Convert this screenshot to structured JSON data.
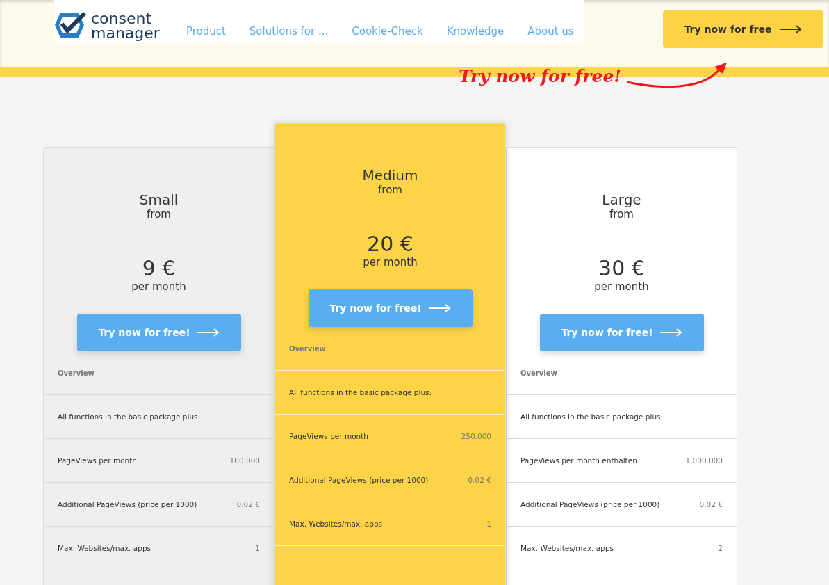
{
  "header": {
    "logo_text": [
      "consent",
      "manager"
    ],
    "nav": [
      {
        "label": "Product"
      },
      {
        "label": "Solutions for ..."
      },
      {
        "label": "Cookie-Check"
      },
      {
        "label": "Knowledge"
      },
      {
        "label": "About us"
      }
    ],
    "cta": {
      "label": "Try now for free"
    },
    "annotation": "Try now for free!"
  },
  "plans": [
    {
      "name": "Small",
      "from": "from",
      "price": "9 €",
      "period": "per month",
      "button": "Try now for free!",
      "kind": "gray",
      "overview": "Overview",
      "rows": [
        {
          "label": "All functions in the basic package plus:"
        },
        {
          "label": "PageViews per month",
          "value": "100.000"
        },
        {
          "label": "Additional PageViews (price per 1000)",
          "value": "0.02 €"
        },
        {
          "label": "Max. Websites/max. apps",
          "value": "1"
        }
      ]
    },
    {
      "name": "Medium",
      "from": "from",
      "price": "20 €",
      "period": "per month",
      "button": "Try now for free!",
      "kind": "featured",
      "overview": "Overview",
      "rows": [
        {
          "label": "All functions in the basic package plus:"
        },
        {
          "label": "PageViews per month",
          "value": "250.000"
        },
        {
          "label": "Additional PageViews (price per 1000)",
          "value": "0.02 €"
        },
        {
          "label": "Max. Websites/max. apps",
          "value": "1"
        }
      ]
    },
    {
      "name": "Large",
      "from": "from",
      "price": "30 €",
      "period": "per month",
      "button": "Try now for free!",
      "kind": "plain",
      "overview": "Overview",
      "rows": [
        {
          "label": "All functions in the basic package plus:"
        },
        {
          "label": "PageViews per month enthalten",
          "value": "1.000.000"
        },
        {
          "label": "Additional PageViews (price per 1000)",
          "value": "0.02 €"
        },
        {
          "label": "Max. Websites/max. apps",
          "value": "2"
        }
      ]
    }
  ]
}
